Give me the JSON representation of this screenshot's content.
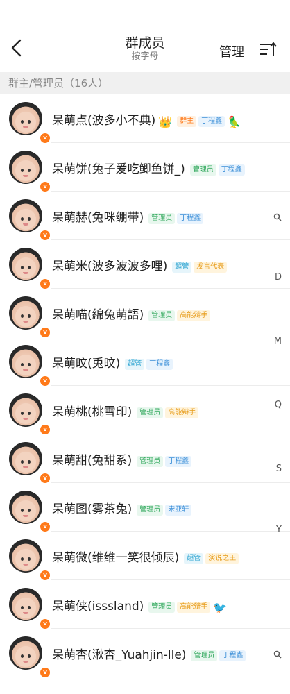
{
  "nav": {
    "title": "群成员",
    "subtitle": "按字母",
    "manage_label": "管理"
  },
  "section": {
    "label": "群主/管理员（16人）"
  },
  "members": [
    {
      "name": "呆萌点(波多小不典)",
      "tags": [
        {
          "text": "群主",
          "style": "owner"
        },
        {
          "text": "丁程鑫",
          "style": "title-blue"
        }
      ],
      "crown": "👑",
      "extra_icon": "🦜"
    },
    {
      "name": "呆萌饼(兔子爱吃鲫鱼饼_)",
      "tags": [
        {
          "text": "管理员",
          "style": "admin"
        },
        {
          "text": "丁程鑫",
          "style": "title-blue"
        }
      ]
    },
    {
      "name": "呆萌赫(兔咪绷带)",
      "tags": [
        {
          "text": "管理员",
          "style": "admin"
        },
        {
          "text": "丁程鑫",
          "style": "title-blue"
        }
      ]
    },
    {
      "name": "呆萌米(波多波波多哩)",
      "tags": [
        {
          "text": "超管",
          "style": "super"
        },
        {
          "text": "发言代表",
          "style": "title-orange"
        }
      ]
    },
    {
      "name": "呆萌喵(綿兔萌語)",
      "tags": [
        {
          "text": "管理员",
          "style": "admin"
        },
        {
          "text": "高能辩手",
          "style": "title-orange"
        }
      ]
    },
    {
      "name": "呆萌旼(兎旼)",
      "tags": [
        {
          "text": "超管",
          "style": "super"
        },
        {
          "text": "丁程鑫",
          "style": "title-blue"
        }
      ]
    },
    {
      "name": "呆萌桃(桃雪印)",
      "tags": [
        {
          "text": "管理员",
          "style": "admin"
        },
        {
          "text": "高能辩手",
          "style": "title-orange"
        }
      ]
    },
    {
      "name": "呆萌甜(兔甜系)",
      "tags": [
        {
          "text": "管理员",
          "style": "admin"
        },
        {
          "text": "丁程鑫",
          "style": "title-blue"
        }
      ]
    },
    {
      "name": "呆萌图(雾茶兔)",
      "tags": [
        {
          "text": "管理员",
          "style": "admin"
        },
        {
          "text": "宋亚轩",
          "style": "title-blue"
        }
      ]
    },
    {
      "name": "呆萌微(维维一笑很倾辰)",
      "tags": [
        {
          "text": "超管",
          "style": "super"
        },
        {
          "text": "演说之王",
          "style": "title-orange"
        }
      ]
    },
    {
      "name": "呆萌侠(isssland)",
      "tags": [
        {
          "text": "管理员",
          "style": "admin"
        },
        {
          "text": "高能辩手",
          "style": "title-orange"
        }
      ],
      "extra_icon": "🐦"
    },
    {
      "name": "呆萌杏(湫杏_Yuahjin-lle)",
      "tags": [
        {
          "text": "管理员",
          "style": "admin"
        },
        {
          "text": "丁程鑫",
          "style": "title-blue"
        }
      ]
    }
  ],
  "index_bar": [
    "D",
    "M",
    "Q",
    "S",
    "Y"
  ],
  "colors": {
    "vip_badge": "#ff7a1a",
    "section_bg": "#f0f0f0"
  },
  "icons": {
    "back": "chevron-left-icon",
    "sort": "sort-icon",
    "index_search": "search-icon"
  }
}
